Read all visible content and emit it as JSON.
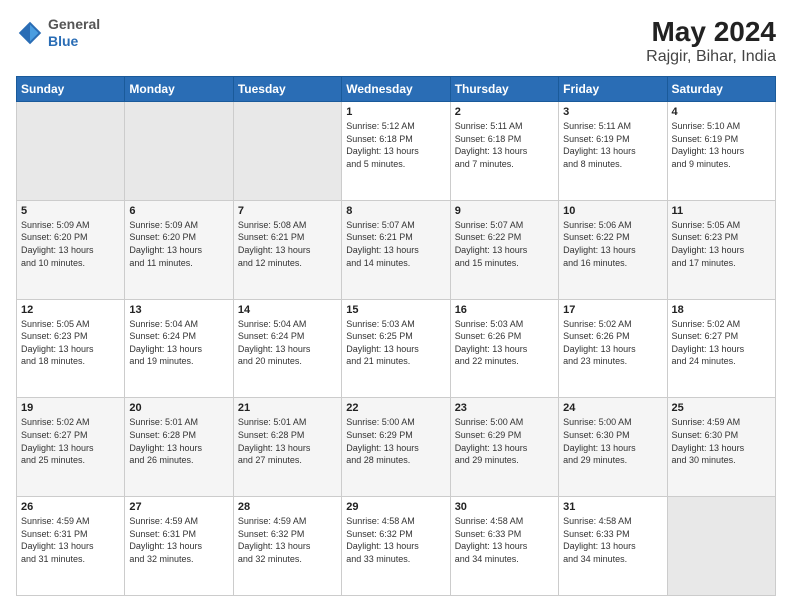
{
  "header": {
    "logo_line1": "General",
    "logo_line2": "Blue",
    "title": "May 2024",
    "subtitle": "Rajgir, Bihar, India"
  },
  "days_of_week": [
    "Sunday",
    "Monday",
    "Tuesday",
    "Wednesday",
    "Thursday",
    "Friday",
    "Saturday"
  ],
  "weeks": [
    [
      {
        "day": "",
        "info": ""
      },
      {
        "day": "",
        "info": ""
      },
      {
        "day": "",
        "info": ""
      },
      {
        "day": "1",
        "info": "Sunrise: 5:12 AM\nSunset: 6:18 PM\nDaylight: 13 hours\nand 5 minutes."
      },
      {
        "day": "2",
        "info": "Sunrise: 5:11 AM\nSunset: 6:18 PM\nDaylight: 13 hours\nand 7 minutes."
      },
      {
        "day": "3",
        "info": "Sunrise: 5:11 AM\nSunset: 6:19 PM\nDaylight: 13 hours\nand 8 minutes."
      },
      {
        "day": "4",
        "info": "Sunrise: 5:10 AM\nSunset: 6:19 PM\nDaylight: 13 hours\nand 9 minutes."
      }
    ],
    [
      {
        "day": "5",
        "info": "Sunrise: 5:09 AM\nSunset: 6:20 PM\nDaylight: 13 hours\nand 10 minutes."
      },
      {
        "day": "6",
        "info": "Sunrise: 5:09 AM\nSunset: 6:20 PM\nDaylight: 13 hours\nand 11 minutes."
      },
      {
        "day": "7",
        "info": "Sunrise: 5:08 AM\nSunset: 6:21 PM\nDaylight: 13 hours\nand 12 minutes."
      },
      {
        "day": "8",
        "info": "Sunrise: 5:07 AM\nSunset: 6:21 PM\nDaylight: 13 hours\nand 14 minutes."
      },
      {
        "day": "9",
        "info": "Sunrise: 5:07 AM\nSunset: 6:22 PM\nDaylight: 13 hours\nand 15 minutes."
      },
      {
        "day": "10",
        "info": "Sunrise: 5:06 AM\nSunset: 6:22 PM\nDaylight: 13 hours\nand 16 minutes."
      },
      {
        "day": "11",
        "info": "Sunrise: 5:05 AM\nSunset: 6:23 PM\nDaylight: 13 hours\nand 17 minutes."
      }
    ],
    [
      {
        "day": "12",
        "info": "Sunrise: 5:05 AM\nSunset: 6:23 PM\nDaylight: 13 hours\nand 18 minutes."
      },
      {
        "day": "13",
        "info": "Sunrise: 5:04 AM\nSunset: 6:24 PM\nDaylight: 13 hours\nand 19 minutes."
      },
      {
        "day": "14",
        "info": "Sunrise: 5:04 AM\nSunset: 6:24 PM\nDaylight: 13 hours\nand 20 minutes."
      },
      {
        "day": "15",
        "info": "Sunrise: 5:03 AM\nSunset: 6:25 PM\nDaylight: 13 hours\nand 21 minutes."
      },
      {
        "day": "16",
        "info": "Sunrise: 5:03 AM\nSunset: 6:26 PM\nDaylight: 13 hours\nand 22 minutes."
      },
      {
        "day": "17",
        "info": "Sunrise: 5:02 AM\nSunset: 6:26 PM\nDaylight: 13 hours\nand 23 minutes."
      },
      {
        "day": "18",
        "info": "Sunrise: 5:02 AM\nSunset: 6:27 PM\nDaylight: 13 hours\nand 24 minutes."
      }
    ],
    [
      {
        "day": "19",
        "info": "Sunrise: 5:02 AM\nSunset: 6:27 PM\nDaylight: 13 hours\nand 25 minutes."
      },
      {
        "day": "20",
        "info": "Sunrise: 5:01 AM\nSunset: 6:28 PM\nDaylight: 13 hours\nand 26 minutes."
      },
      {
        "day": "21",
        "info": "Sunrise: 5:01 AM\nSunset: 6:28 PM\nDaylight: 13 hours\nand 27 minutes."
      },
      {
        "day": "22",
        "info": "Sunrise: 5:00 AM\nSunset: 6:29 PM\nDaylight: 13 hours\nand 28 minutes."
      },
      {
        "day": "23",
        "info": "Sunrise: 5:00 AM\nSunset: 6:29 PM\nDaylight: 13 hours\nand 29 minutes."
      },
      {
        "day": "24",
        "info": "Sunrise: 5:00 AM\nSunset: 6:30 PM\nDaylight: 13 hours\nand 29 minutes."
      },
      {
        "day": "25",
        "info": "Sunrise: 4:59 AM\nSunset: 6:30 PM\nDaylight: 13 hours\nand 30 minutes."
      }
    ],
    [
      {
        "day": "26",
        "info": "Sunrise: 4:59 AM\nSunset: 6:31 PM\nDaylight: 13 hours\nand 31 minutes."
      },
      {
        "day": "27",
        "info": "Sunrise: 4:59 AM\nSunset: 6:31 PM\nDaylight: 13 hours\nand 32 minutes."
      },
      {
        "day": "28",
        "info": "Sunrise: 4:59 AM\nSunset: 6:32 PM\nDaylight: 13 hours\nand 32 minutes."
      },
      {
        "day": "29",
        "info": "Sunrise: 4:58 AM\nSunset: 6:32 PM\nDaylight: 13 hours\nand 33 minutes."
      },
      {
        "day": "30",
        "info": "Sunrise: 4:58 AM\nSunset: 6:33 PM\nDaylight: 13 hours\nand 34 minutes."
      },
      {
        "day": "31",
        "info": "Sunrise: 4:58 AM\nSunset: 6:33 PM\nDaylight: 13 hours\nand 34 minutes."
      },
      {
        "day": "",
        "info": ""
      }
    ]
  ]
}
